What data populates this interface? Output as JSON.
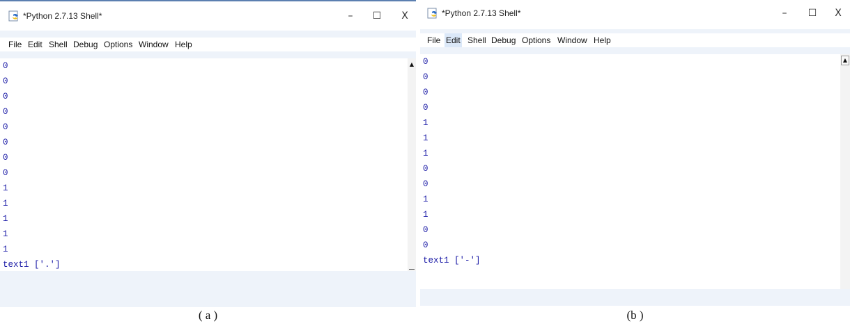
{
  "panels": [
    {
      "title": "*Python 2.7.13 Shell*",
      "controls": {
        "minimize": "–",
        "maximize": "☐",
        "close": "X"
      },
      "menu": [
        "File",
        "Edit",
        "Shell",
        "Debug",
        "Options",
        "Window",
        "Help"
      ],
      "output_lines": [
        "0",
        "0",
        "0",
        "0",
        "0",
        "0",
        "0",
        "0",
        "1",
        "1",
        "1",
        "1",
        "1",
        "text1 ['.']"
      ],
      "caption": "( a )"
    },
    {
      "title": "*Python 2.7.13 Shell*",
      "controls": {
        "minimize": "–",
        "maximize": "☐",
        "close": "X"
      },
      "menu": [
        "File",
        "Edit",
        "Shell",
        "Debug",
        "Options",
        "Window",
        "Help"
      ],
      "active_menu": "Edit",
      "output_lines": [
        "0",
        "0",
        "0",
        "0",
        "1",
        "1",
        "1",
        "0",
        "0",
        "1",
        "1",
        "0",
        "0",
        "text1 ['-']"
      ],
      "caption": "(b )"
    }
  ],
  "icons": {
    "app": "python-idle-icon",
    "scroll_up": "scroll-up-arrow-icon"
  }
}
